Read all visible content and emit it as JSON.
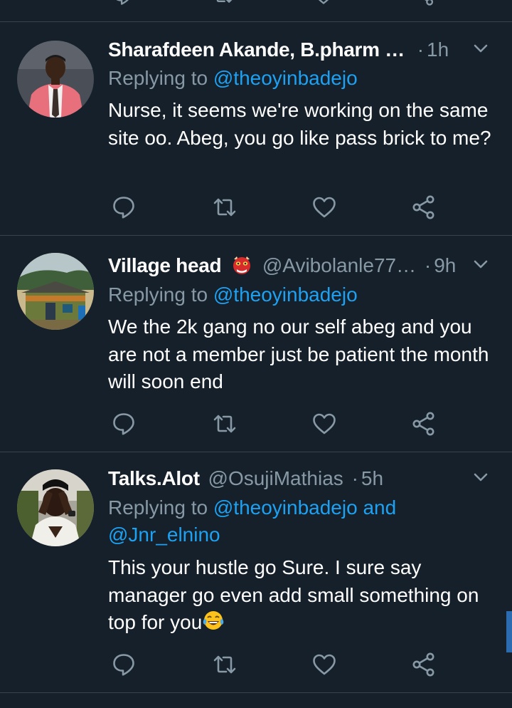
{
  "theme": {
    "background": "#15202b",
    "text": "#ffffff",
    "muted": "#8899a6",
    "link": "#1da1f2",
    "divider": "#38444d"
  },
  "tweets": [
    {
      "name": "Sharafdeen Akande, B.pharm …",
      "handle": "",
      "dot": "·",
      "time": "1h",
      "replying_prefix": "Replying to ",
      "replying_mentions": "@theoyinbadejo",
      "replying_line2": "",
      "body": "Nurse, it seems we're working on the same site oo. Abeg, you go like pass brick to me?",
      "emoji": ""
    },
    {
      "name": "Village head",
      "name_emoji": "red-ogre-emoji",
      "handle": "@Avibolanle77…",
      "dot": "·",
      "time": "9h",
      "replying_prefix": "Replying to ",
      "replying_mentions": "@theoyinbadejo",
      "replying_line2": "",
      "body": "We the 2k gang no our self abeg and you are not a member just be patient the month will soon end",
      "emoji": ""
    },
    {
      "name": "Talks.Alot",
      "handle": "@OsujiMathias",
      "dot": "·",
      "time": "5h",
      "replying_prefix": "Replying to ",
      "replying_mentions": "@theoyinbadejo and",
      "replying_line2": "@Jnr_elnino",
      "body": "This your hustle go Sure. I sure say manager go even add small something on top for you",
      "emoji": "tears-of-joy-emoji"
    }
  ],
  "icons": {
    "reply": "reply-icon",
    "retweet": "retweet-icon",
    "like": "heart-icon",
    "share": "share-icon",
    "menu": "chevron-down-icon"
  }
}
